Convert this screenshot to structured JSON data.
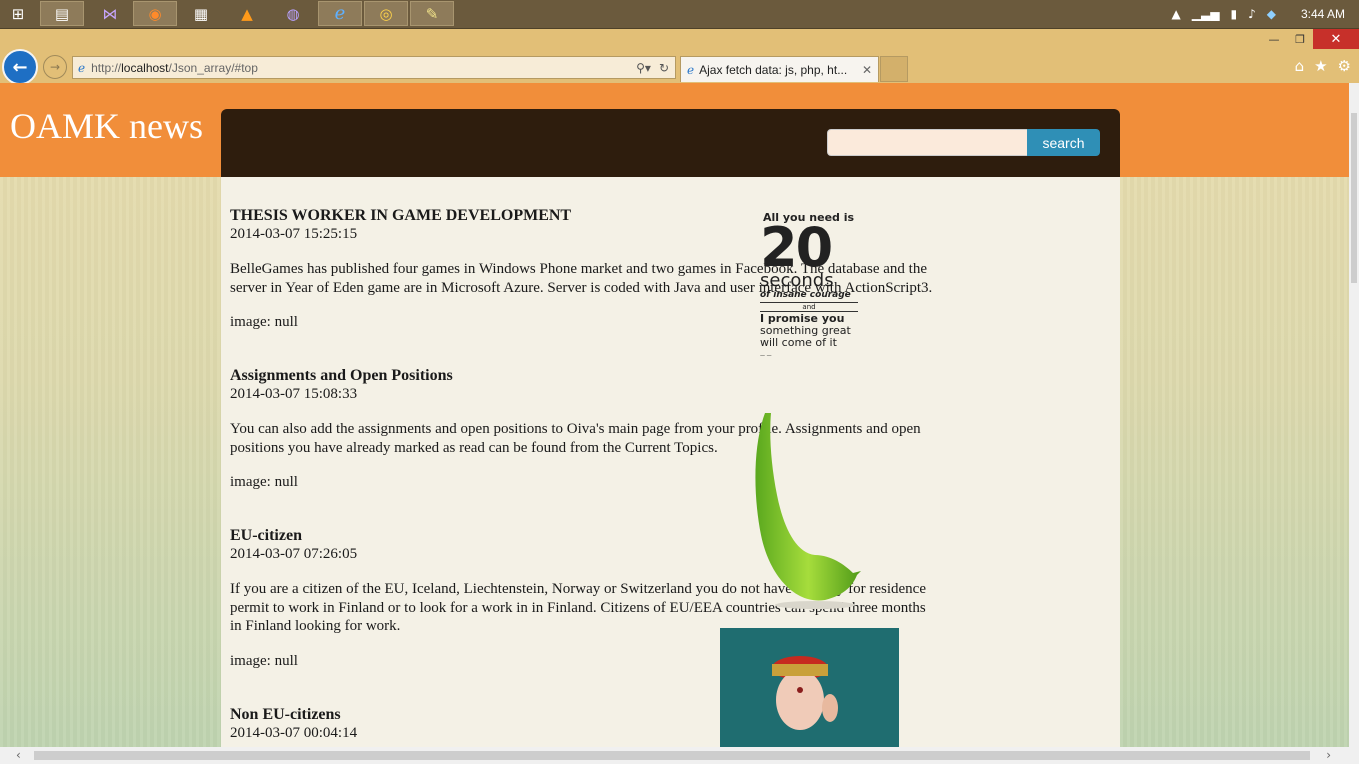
{
  "taskbar": {
    "apps": [
      {
        "name": "start-icon",
        "glyph": "⊞"
      },
      {
        "name": "file-explorer-icon",
        "glyph": "▤"
      },
      {
        "name": "visual-studio-icon",
        "glyph": "⋈"
      },
      {
        "name": "firefox-icon",
        "glyph": "◉"
      },
      {
        "name": "calculator-icon",
        "glyph": "▦"
      },
      {
        "name": "vlc-icon",
        "glyph": "▲"
      },
      {
        "name": "globe-app-icon",
        "glyph": "◍"
      },
      {
        "name": "internet-explorer-icon",
        "glyph": "ℯ"
      },
      {
        "name": "chrome-icon",
        "glyph": "◎"
      },
      {
        "name": "notes-app-icon",
        "glyph": "✎"
      }
    ],
    "time": "3:44 AM"
  },
  "browser": {
    "url_prefix": "http://",
    "url_host": "localhost",
    "url_path": "/Json_array/#top",
    "tab_title": "Ajax fetch data: js, php, ht..."
  },
  "site": {
    "title": "OAMK news",
    "search_placeholder": "",
    "search_button": "search"
  },
  "articles": [
    {
      "title": "THESIS WORKER IN GAME DEVELOPMENT",
      "date": "2014-03-07 15:25:15",
      "body": "BelleGames has published four games in Windows Phone market and two games in Facebook. The database and the server in Year of Eden game are in Microsoft Azure. Server is coded with Java and user interface with ActionScript3.",
      "image": "image: null"
    },
    {
      "title": "Assignments and Open Positions",
      "date": "2014-03-07 15:08:33",
      "body": "You can also add the assignments and open positions to Oiva's main page from your profile. Assignments and open positions you have already marked as read can be found from the Current Topics.",
      "image": "image: null"
    },
    {
      "title": "EU-citizen",
      "date": "2014-03-07 07:26:05",
      "body": "If you are a citizen of the EU, Iceland, Liechtenstein, Norway or Switzerland you do not have to apply for residence permit to work in Finland or to look for a work in in Finland. Citizens of EU/EEA countries can spend three months in Finland looking for work.",
      "image": "image: null"
    },
    {
      "title": "Non EU-citizens",
      "date": "2014-03-07 00:04:14",
      "body": "",
      "image": ""
    }
  ],
  "poster": {
    "line1": "All you need is",
    "number": "20",
    "unit": "seconds",
    "line2": "of insane courage",
    "line3": "and",
    "line4": "I promise you",
    "line5": "something great",
    "line6": "will come of it"
  }
}
